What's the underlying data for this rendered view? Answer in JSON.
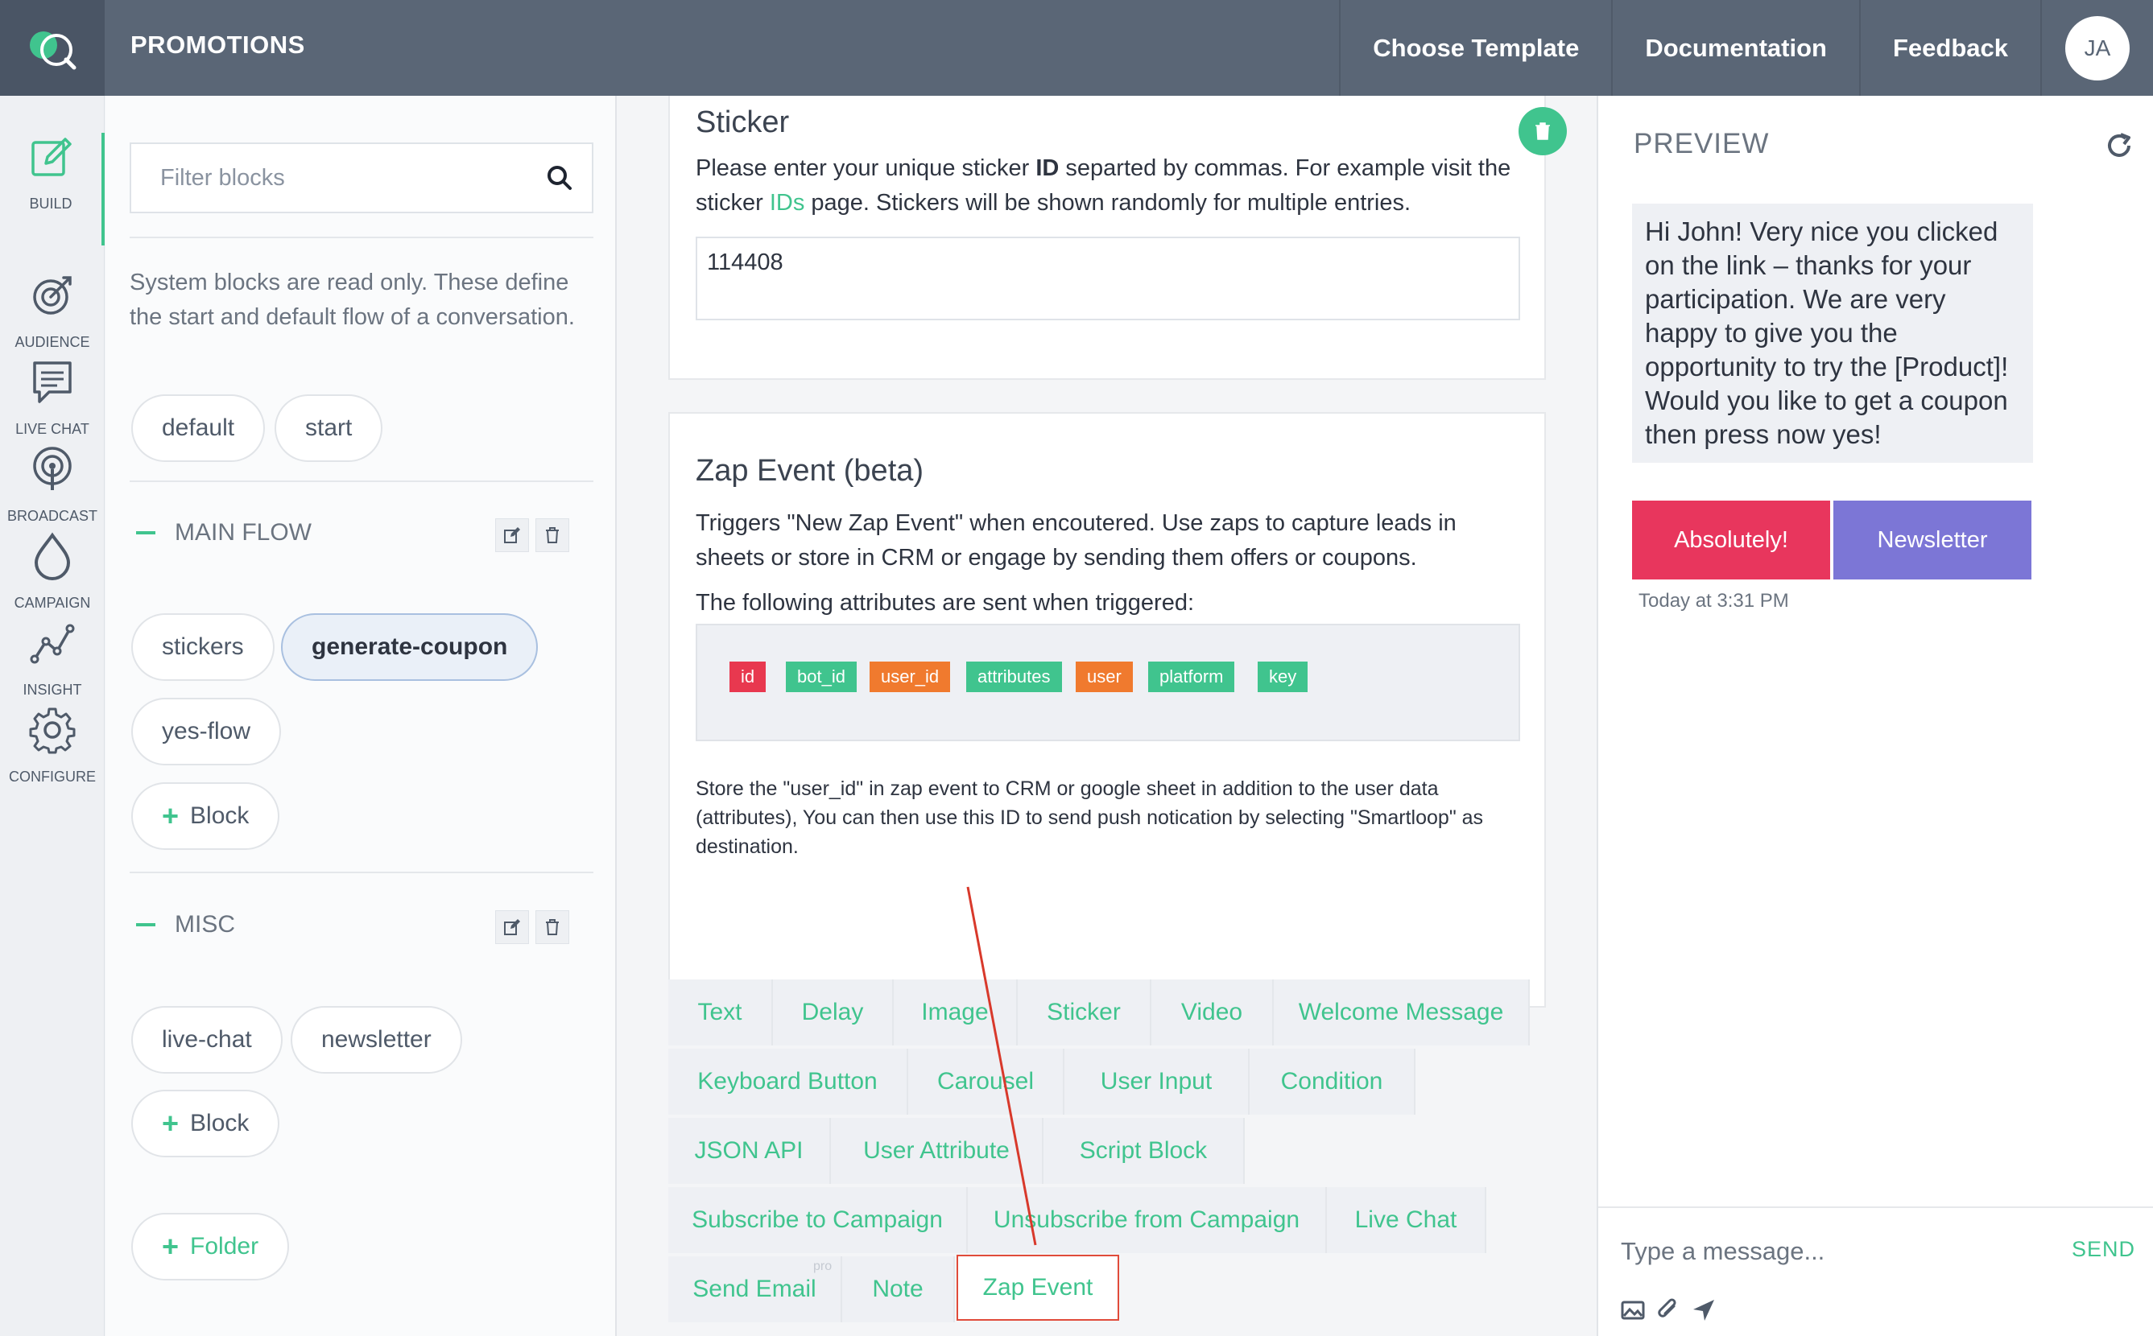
{
  "app": {
    "title": "PROMOTIONS",
    "nav": [
      "Choose Template",
      "Documentation",
      "Feedback"
    ],
    "avatar_initials": "JA",
    "accent_color": "#40c48e",
    "header_color": "#5a6676"
  },
  "rail": {
    "items": [
      {
        "label": "BUILD",
        "icon": "edit-icon",
        "active": true
      },
      {
        "label": "AUDIENCE",
        "icon": "target-icon"
      },
      {
        "label": "LIVE CHAT",
        "icon": "chat-icon"
      },
      {
        "label": "BROADCAST",
        "icon": "broadcast-icon"
      },
      {
        "label": "CAMPAIGN",
        "icon": "drop-icon"
      },
      {
        "label": "INSIGHT",
        "icon": "insight-icon"
      },
      {
        "label": "CONFIGURE",
        "icon": "gear-icon"
      }
    ],
    "help_label": "?"
  },
  "blocks": {
    "filter_placeholder": "Filter blocks",
    "system_note": "System blocks are read only. These define the start and default flow of a conversation.",
    "system_blocks": [
      "default",
      "start"
    ],
    "main_flow": {
      "title": "MAIN FLOW",
      "blocks": [
        "stickers",
        "generate-coupon",
        "yes-flow"
      ],
      "selected": "generate-coupon",
      "add_label": "Block"
    },
    "misc": {
      "title": "MISC",
      "blocks": [
        "live-chat",
        "newsletter"
      ],
      "add_label": "Block"
    },
    "add_folder_label": "Folder"
  },
  "sticker_card": {
    "title": "Sticker",
    "text_before": "Please enter your unique sticker ",
    "text_bold": "ID",
    "text_middle": " separted by commas. For example visit the sticker ",
    "link": "IDs",
    "text_after": " page. Stickers will be shown randomly for multiple entries.",
    "value": "114408"
  },
  "zap_card": {
    "title": "Zap Event (beta)",
    "description": "Triggers \"New Zap Event\" when encoutered. Use zaps to capture leads in sheets or store in CRM or engage by sending them offers or coupons.",
    "attributes_label": "The following attributes are sent when triggered:",
    "attributes": [
      {
        "name": "id",
        "color": "#e8384f"
      },
      {
        "name": "bot_id",
        "color": "#40c48e"
      },
      {
        "name": "user_id",
        "color": "#f07a2e"
      },
      {
        "name": "attributes",
        "color": "#40c48e"
      },
      {
        "name": "user",
        "color": "#f07a2e"
      },
      {
        "name": "platform",
        "color": "#40c48e"
      },
      {
        "name": "key",
        "color": "#40c48e"
      }
    ],
    "store_note": "Store the \"user_id\" in zap event to CRM or google sheet in addition to the user data (attributes), You can then use this ID to send push notication by selecting \"Smartloop\" as destination."
  },
  "block_types": {
    "rows": [
      [
        "Text",
        "Delay",
        "Image",
        "Sticker",
        "Video",
        "Welcome Message"
      ],
      [
        "Keyboard Button",
        "Carousel",
        "User Input",
        "Condition"
      ],
      [
        "JSON API",
        "User Attribute",
        "Script Block"
      ],
      [
        "Subscribe to Campaign",
        "Unsubscribe from Campaign",
        "Live Chat"
      ],
      [
        "Send Email",
        "Note",
        "Zap Event"
      ]
    ],
    "pro_badge": "pro",
    "highlighted": "Zap Event"
  },
  "preview": {
    "title": "PREVIEW",
    "message": "Hi John! Very nice you clicked on the link – thanks for your participation. We are very happy to give you the opportunity to try the [Product]! Would you like to get a coupon then press now yes!",
    "buttons": [
      {
        "label": "Absolutely!",
        "color": "#e8365d"
      },
      {
        "label": "Newsletter",
        "color": "#7c76d6"
      }
    ],
    "timestamp": "Today at 3:31 PM",
    "input_placeholder": "Type a message...",
    "send_label": "SEND"
  }
}
